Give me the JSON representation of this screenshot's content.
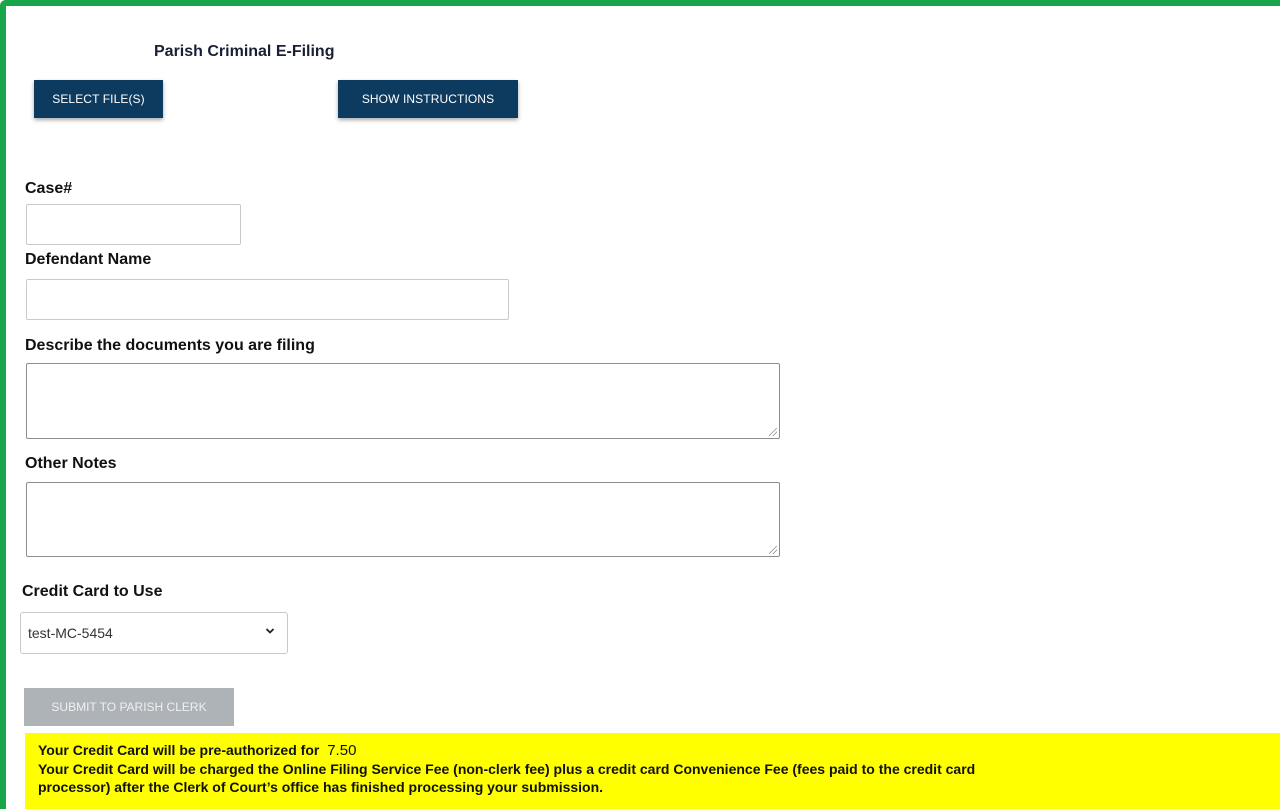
{
  "page": {
    "title": "Parish Criminal E-Filing"
  },
  "toolbar": {
    "select_files_label": "SELECT FILE(S)",
    "show_instructions_label": "SHOW INSTRUCTIONS"
  },
  "form": {
    "case_label": "Case#",
    "case_value": "",
    "defendant_label": "Defendant Name",
    "defendant_value": "",
    "documents_label": "Describe the documents you are filing",
    "documents_value": "",
    "notes_label": "Other Notes",
    "notes_value": "",
    "credit_card_label": "Credit Card to Use",
    "credit_card_selected": "test-MC-5454",
    "submit_label": "SUBMIT TO PARISH CLERK"
  },
  "notice": {
    "preauth_text": "Your Credit Card will be pre-authorized for",
    "preauth_amount": "7.50",
    "charge_line_1": "Your Credit Card will be charged the Online Filing Service Fee (non-clerk fee) plus a credit card Convenience Fee (fees paid to the credit card",
    "charge_line_2": "processor) after  the Clerk of Court’s office has finished processing your submission."
  },
  "colors": {
    "frame_border": "#17a64a",
    "primary_button": "#0d3a5f",
    "disabled_button": "#aeb3b8",
    "notice_background": "#ffff00"
  },
  "icons": {
    "select_arrow": "chevron-down-icon",
    "resize_handle": "resize-grip-icon"
  }
}
